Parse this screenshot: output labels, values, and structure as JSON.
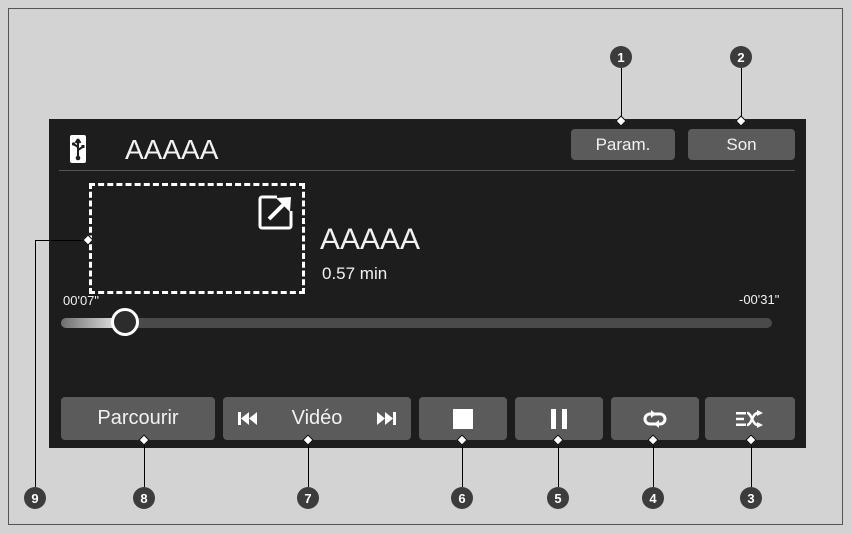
{
  "header": {
    "source_icon": "usb-icon",
    "title": "AAAAA",
    "settings_label": "Param.",
    "sound_label": "Son"
  },
  "now_playing": {
    "album_art_expand_icon": "expand-icon",
    "title": "AAAAA",
    "duration": "0.57 min",
    "elapsed": "00'07\"",
    "remaining": "-00'31\"",
    "progress_fraction": 0.09
  },
  "controls": {
    "browse_label": "Parcourir",
    "mode_label": "Vidéo",
    "prev_icon": "skip-previous-icon",
    "next_icon": "skip-next-icon",
    "stop_icon": "stop-icon",
    "pause_icon": "pause-icon",
    "repeat_icon": "repeat-icon",
    "shuffle_icon": "shuffle-icon"
  },
  "callouts": [
    "1",
    "2",
    "3",
    "4",
    "5",
    "6",
    "7",
    "8",
    "9"
  ],
  "colors": {
    "screen_bg": "#1d1d1d",
    "button_bg": "#5b5b5b",
    "page_bg": "#d3d3d3"
  }
}
